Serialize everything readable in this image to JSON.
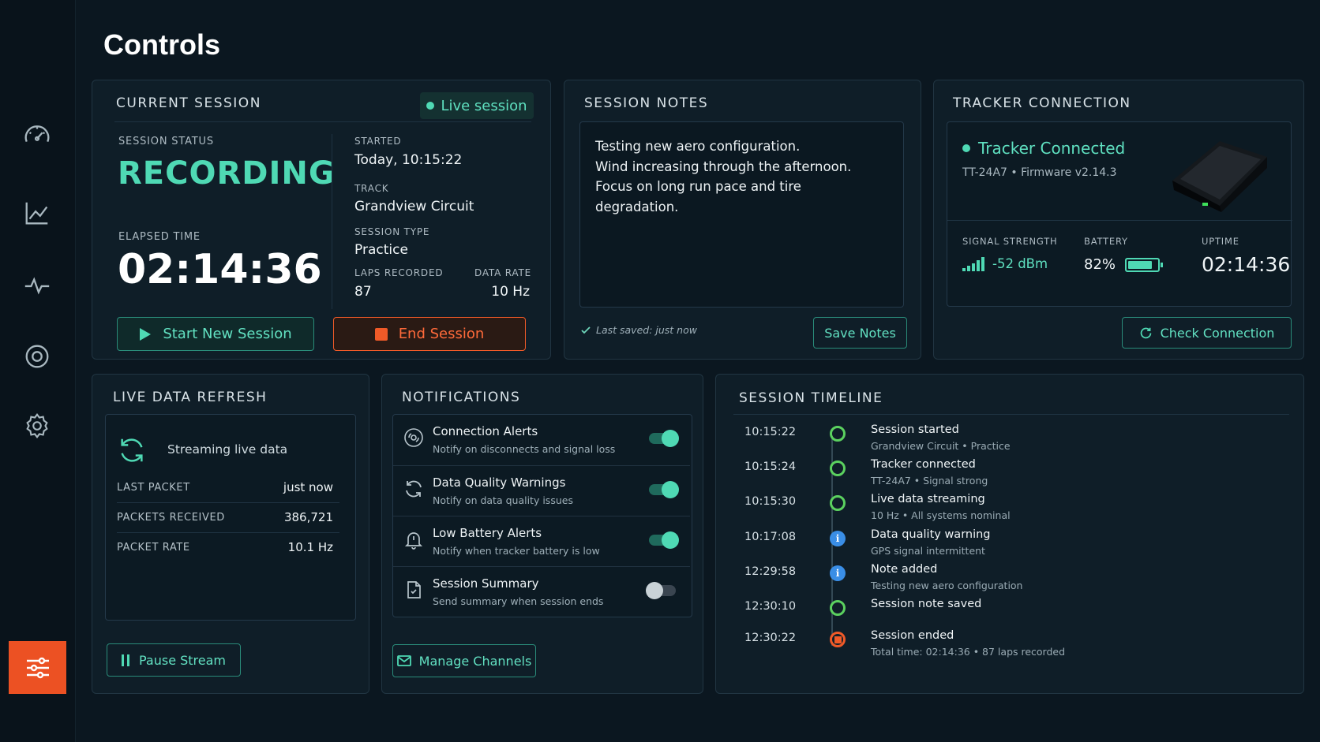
{
  "page": {
    "title": "Controls"
  },
  "sidebar": {
    "items": [
      {
        "icon": "speedometer-icon"
      },
      {
        "icon": "line-chart-icon"
      },
      {
        "icon": "pulse-icon"
      },
      {
        "icon": "target-icon"
      },
      {
        "icon": "gear-icon"
      },
      {
        "icon": "sliders-icon",
        "active": true
      }
    ]
  },
  "current_session": {
    "title": "CURRENT SESSION",
    "badge": "Live session",
    "status_label": "SESSION STATUS",
    "status_value": "RECORDING",
    "elapsed_label": "ELAPSED TIME",
    "elapsed_value": "02:14:36",
    "started_label": "STARTED",
    "started_value": "Today, 10:15:22",
    "track_label": "TRACK",
    "track_value": "Grandview Circuit",
    "type_label": "SESSION TYPE",
    "type_value": "Practice",
    "laps_label": "LAPS RECORDED",
    "laps_value": "87",
    "rate_label": "DATA RATE",
    "rate_value": "10 Hz",
    "start_button": "Start New Session",
    "end_button": "End Session"
  },
  "session_notes": {
    "title": "SESSION NOTES",
    "lines": [
      "Testing new aero configuration.",
      "Wind increasing through the afternoon.",
      "Focus on long run pace and tire",
      "degradation."
    ],
    "saved_text": "Last saved: just now",
    "save_button": "Save Notes"
  },
  "tracker": {
    "title": "TRACKER CONNECTION",
    "status": "Tracker Connected",
    "device": "TT-24A7 • Firmware v2.14.3",
    "signal_label": "SIGNAL STRENGTH",
    "signal_value": "-52 dBm",
    "battery_label": "BATTERY",
    "battery_value": "82%",
    "battery_level": 0.82,
    "uptime_label": "UPTIME",
    "uptime_value": "02:14:36",
    "check_button": "Check Connection"
  },
  "live_data": {
    "title": "LIVE DATA REFRESH",
    "streaming": "Streaming live data",
    "stats": [
      {
        "k": "LAST PACKET",
        "v": "just now"
      },
      {
        "k": "PACKETS RECEIVED",
        "v": "386,721"
      },
      {
        "k": "PACKET RATE",
        "v": "10.1 Hz"
      }
    ],
    "pause_button": "Pause Stream"
  },
  "notifications": {
    "title": "NOTIFICATIONS",
    "items": [
      {
        "title": "Connection Alerts",
        "sub": "Notify on disconnects and signal loss",
        "on": true,
        "icon": "connection-icon"
      },
      {
        "title": "Data Quality Warnings",
        "sub": "Notify on data quality issues",
        "on": true,
        "icon": "refresh-icon"
      },
      {
        "title": "Low Battery Alerts",
        "sub": "Notify when tracker battery is low",
        "on": true,
        "icon": "bell-icon"
      },
      {
        "title": "Session Summary",
        "sub": "Send summary when session ends",
        "on": false,
        "icon": "document-icon"
      }
    ],
    "manage_button": "Manage Channels"
  },
  "timeline": {
    "title": "SESSION TIMELINE",
    "events": [
      {
        "time": "10:15:22",
        "title": "Session started",
        "sub": "Grandview Circuit • Practice",
        "kind": "ok"
      },
      {
        "time": "10:15:24",
        "title": "Tracker connected",
        "sub": "TT-24A7 • Signal strong",
        "kind": "ok"
      },
      {
        "time": "10:15:30",
        "title": "Live data streaming",
        "sub": "10 Hz • All systems nominal",
        "kind": "ok"
      },
      {
        "time": "10:17:08",
        "title": "Data quality warning",
        "sub": "GPS signal intermittent",
        "kind": "info"
      },
      {
        "time": "12:29:58",
        "title": "Note added",
        "sub": "Testing new aero configuration",
        "kind": "info"
      },
      {
        "time": "12:30:10",
        "title": "Session note saved",
        "sub": "",
        "kind": "ok"
      },
      {
        "time": "12:30:22",
        "title": "Session ended",
        "sub": "Total time: 02:14:36 • 87 laps recorded",
        "kind": "stop"
      }
    ]
  },
  "colors": {
    "accent": "#4fd9b4",
    "danger": "#f05a28",
    "ok_green": "#5bd15f",
    "info_blue": "#3a8ee6"
  }
}
